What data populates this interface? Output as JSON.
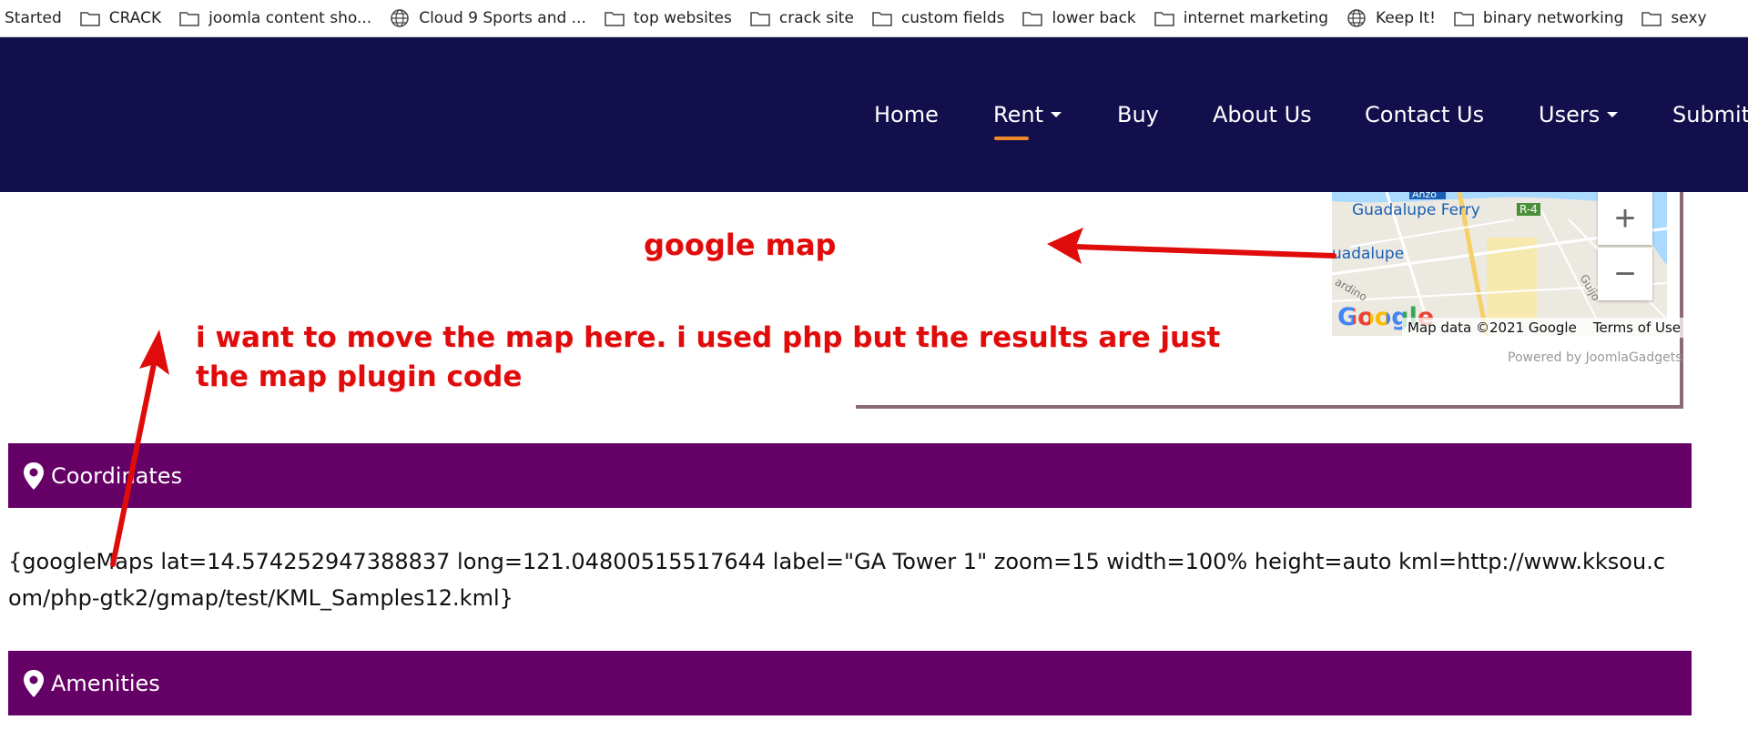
{
  "bookmarks": [
    {
      "label": "Started",
      "icon": "none"
    },
    {
      "label": "CRACK",
      "icon": "folder-icon"
    },
    {
      "label": "joomla content sho...",
      "icon": "folder-icon"
    },
    {
      "label": "Cloud 9 Sports and ...",
      "icon": "globe-icon"
    },
    {
      "label": "top websites",
      "icon": "folder-icon"
    },
    {
      "label": "crack site",
      "icon": "folder-icon"
    },
    {
      "label": "custom fields",
      "icon": "folder-icon"
    },
    {
      "label": "lower back",
      "icon": "folder-icon"
    },
    {
      "label": "internet marketing",
      "icon": "folder-icon"
    },
    {
      "label": "Keep It!",
      "icon": "globe-icon"
    },
    {
      "label": "binary networking",
      "icon": "folder-icon"
    },
    {
      "label": "sexy",
      "icon": "folder-icon"
    }
  ],
  "nav": {
    "items": [
      "Home",
      "Rent",
      "Buy",
      "About Us",
      "Contact Us",
      "Users",
      "Submit"
    ],
    "active": "Rent",
    "dropdown_items": [
      "Rent",
      "Users"
    ]
  },
  "map": {
    "labels": {
      "ferry": "Guadalupe Ferry",
      "route": "R-4",
      "guadalupe": "uadalupe",
      "road1": "Anzo",
      "road2": "Guijo",
      "road3": "ardino"
    },
    "zoom_in": "+",
    "zoom_out": "−",
    "google_logo": "Google",
    "map_data": "Map data ©2021 Google",
    "terms": "Terms of Use",
    "powered_by": "Powered by JoomlaGadgets"
  },
  "annotations": {
    "map_label": "google map",
    "move_note": "i want to move the map here. i used php but the results are just the map plugin code"
  },
  "sections": {
    "coordinates": "Coordinates",
    "amenities": "Amenities"
  },
  "plugin_code": "{googleMaps lat=14.574252947388837 long=121.04800515517644 label=\"GA Tower 1\" zoom=15 width=100% height=auto kml=http://www.kksou.com/php-gtk2/gmap/test/KML_Samples12.kml}",
  "colors": {
    "navbar_bg": "#120f4c",
    "active_underline": "#f0892b",
    "section_bg": "#650066",
    "annotation_red": "#e00b0b"
  }
}
